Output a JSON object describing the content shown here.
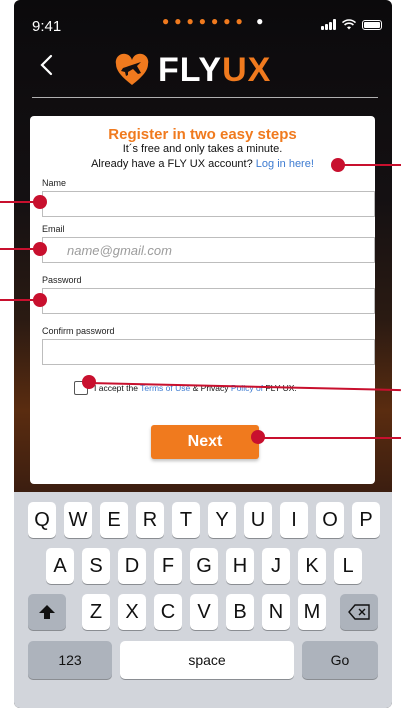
{
  "status_bar": {
    "time": "9:41",
    "dots_orange": "●●●●●●●",
    "dots_white": "●",
    "icons": [
      "signal-icon",
      "wifi-icon",
      "battery-icon"
    ]
  },
  "header": {
    "back_icon": "chevron-left-icon",
    "logo_fly": "FLY",
    "logo_ux": "UX",
    "logo_icon": "plane-heart-icon"
  },
  "form": {
    "title": "Register in two easy steps",
    "subtitle": "It´s free and only takes a minute.",
    "account_prompt": "Already have a FLY UX account?",
    "login_link": "Log in here!",
    "name_label": "Name",
    "name_value": "",
    "email_label": "Email",
    "email_placeholder": "name@gmail.com",
    "password_label": "Password",
    "password_value": "",
    "confirm_label": "Confirm password",
    "confirm_value": "",
    "terms_prefix": "I accept the",
    "terms_link": "Terms of Use",
    "terms_mid": "& Privacy",
    "policy_link": "Policy of",
    "terms_suffix": "FLY UX.",
    "next_label": "Next"
  },
  "keyboard": {
    "row1": [
      "Q",
      "W",
      "E",
      "R",
      "T",
      "Y",
      "U",
      "I",
      "O",
      "P"
    ],
    "row2": [
      "A",
      "S",
      "D",
      "F",
      "G",
      "H",
      "J",
      "K",
      "L"
    ],
    "row3": [
      "Z",
      "X",
      "C",
      "V",
      "B",
      "N",
      "M"
    ],
    "shift_icon": "shift-icon",
    "delete_icon": "backspace-icon",
    "numbers_label": "123",
    "space_label": "space",
    "go_label": "Go"
  },
  "colors": {
    "accent": "#f07a1e",
    "link": "#3d7bd1",
    "annotation": "#c8102e",
    "keyboard_bg": "#d2d5db"
  }
}
